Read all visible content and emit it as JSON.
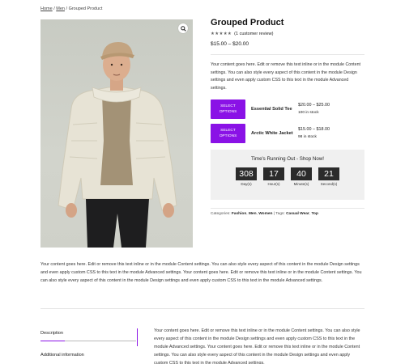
{
  "breadcrumb": {
    "home": "Home",
    "sep1": " / ",
    "category": "Men",
    "sep2": " / ",
    "current": "Grouped Product"
  },
  "product": {
    "title": "Grouped Product",
    "rating_stars": "★★★★★",
    "rating_text": "(1 customer review)",
    "price_range": "$15.00 – $20.00",
    "short_description": "Your content goes here. Edit or remove this text inline or in the module Content settings. You can also style every aspect of this content in the module Design settings and even apply custom CSS to this text in the module Advanced settings."
  },
  "grouped_items": [
    {
      "button": "SELECT OPTIONS",
      "name": "Essential Solid Tee",
      "price": "$20.00 – $25.00",
      "stock": "100 in stock"
    },
    {
      "button": "SELECT OPTIONS",
      "name": "Arctic White Jacket",
      "price": "$15.00 – $18.00",
      "stock": "98 in stock"
    }
  ],
  "countdown": {
    "title": "Time's Running Out - Shop Now!",
    "units": [
      {
        "value": "308",
        "label": "Day(s)"
      },
      {
        "value": "17",
        "label": "Hour(s)"
      },
      {
        "value": "40",
        "label": "Minute(s)"
      },
      {
        "value": "21",
        "label": "Second(s)"
      }
    ]
  },
  "meta": {
    "categories_label": "Categories:",
    "categories": [
      "Fashion",
      "Men",
      "Women"
    ],
    "tags_label": "Tags:",
    "tags": [
      "Casual Wear",
      "Top"
    ]
  },
  "long_description": "Your content goes here. Edit or remove this text inline or in the module Content settings. You can also style every aspect of this content in the module Design settings and even apply custom CSS to this text in the module Advanced settings. Your content goes here. Edit or remove this text inline or in the module Content settings. You can also style every aspect of this content in the module Design settings and even apply custom CSS to this text in the module Advanced settings.",
  "tabs": [
    {
      "label": "Description"
    },
    {
      "label": "Additional information"
    }
  ],
  "tab_content": "Your content goes here. Edit or remove this text inline or in the module Content settings. You can also style every aspect of this content in the module Design settings and even apply custom CSS to this text in the module Advanced settings. Your content goes here. Edit or remove this text inline or in the module Content settings. You can also style every aspect of this content in the module Design settings and even apply custom CSS to this text in the module Advanced settings.",
  "colors": {
    "accent": "#8a12e6",
    "timer_bg": "#2b2b2b",
    "countdown_bg": "#f0f0f0"
  },
  "icons": {
    "zoom": "magnifier-icon"
  }
}
